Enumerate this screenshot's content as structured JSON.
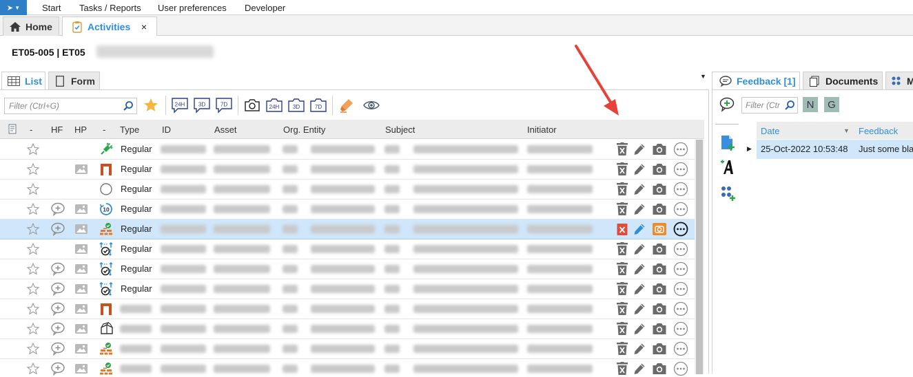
{
  "menu": {
    "items": [
      "Start",
      "Tasks / Reports",
      "User preferences",
      "Developer"
    ]
  },
  "tabs": {
    "home": "Home",
    "activities": "Activities",
    "close": "×"
  },
  "page": {
    "title": "ET05-005 | ET05"
  },
  "left_tabs": {
    "list": "List",
    "form": "Form"
  },
  "toolbar": {
    "filter_placeholder": "Filter (Ctrl+G)",
    "period_labels": [
      "24H",
      "3D",
      "7D"
    ],
    "camera_labels": [
      "24H",
      "3D",
      "7D"
    ]
  },
  "grid": {
    "columns": [
      "-",
      "HF",
      "HP",
      "-",
      "Type",
      "ID",
      "Asset",
      "Org. Entity",
      "Subject",
      "Initiator"
    ],
    "rows": [
      {
        "type": "Regular",
        "hf": false,
        "hp": false,
        "status": "plug",
        "selected": false,
        "blur_type": false
      },
      {
        "type": "Regular",
        "hf": false,
        "hp": true,
        "status": "columns",
        "selected": false,
        "blur_type": false
      },
      {
        "type": "Regular",
        "hf": false,
        "hp": false,
        "status": "circle",
        "selected": false,
        "blur_type": false
      },
      {
        "type": "Regular",
        "hf": true,
        "hp": true,
        "status": "timer",
        "selected": false,
        "blur_type": false
      },
      {
        "type": "Regular",
        "hf": true,
        "hp": true,
        "status": "bricks",
        "selected": true,
        "blur_type": false
      },
      {
        "type": "Regular",
        "hf": false,
        "hp": true,
        "status": "check-arrows",
        "selected": false,
        "blur_type": false
      },
      {
        "type": "Regular",
        "hf": true,
        "hp": true,
        "status": "check-arrows",
        "selected": false,
        "blur_type": false
      },
      {
        "type": "Regular",
        "hf": true,
        "hp": true,
        "status": "check-arrows",
        "selected": false,
        "blur_type": false
      },
      {
        "type": "",
        "hf": true,
        "hp": true,
        "status": "columns",
        "selected": false,
        "blur_type": true
      },
      {
        "type": "",
        "hf": true,
        "hp": true,
        "status": "box",
        "selected": false,
        "blur_type": true
      },
      {
        "type": "",
        "hf": true,
        "hp": true,
        "status": "bricks",
        "selected": false,
        "blur_type": true
      },
      {
        "type": "",
        "hf": true,
        "hp": true,
        "status": "bricks",
        "selected": false,
        "blur_type": true
      }
    ]
  },
  "right_tabs": {
    "feedback": "Feedback [1]",
    "documents": "Documents",
    "more": "M"
  },
  "feedback": {
    "filter_placeholder": "Filter (Ctrl",
    "n_label": "N",
    "g_label": "G",
    "col_date": "Date",
    "col_feedback": "Feedback",
    "row_date": "25-Oct-2022 10:53:48",
    "row_text": "Just some bla"
  },
  "colors": {
    "accent": "#2f8fd8",
    "selected_row": "#cfe6fb",
    "arrow": "#e8413a"
  }
}
